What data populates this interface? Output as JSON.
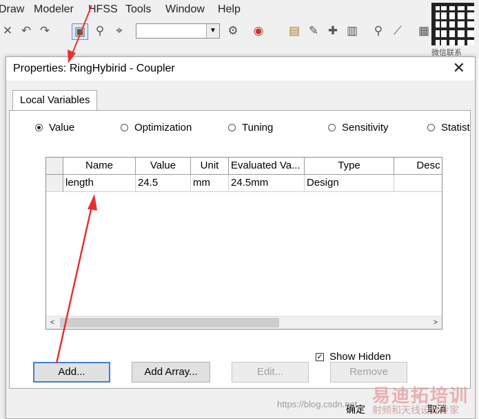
{
  "app": {
    "menu": [
      "Draw",
      "Modeler",
      "HFSS",
      "Tools",
      "Window",
      "Help"
    ],
    "qr_caption": "微信联系"
  },
  "dialog": {
    "title": "Properties: RingHybirid - Coupler",
    "tab": "Local Variables",
    "radios": [
      {
        "label": "Value",
        "selected": true
      },
      {
        "label": "Optimization",
        "selected": false
      },
      {
        "label": "Tuning",
        "selected": false
      },
      {
        "label": "Sensitivity",
        "selected": false
      },
      {
        "label": "Statist",
        "selected": false
      }
    ],
    "table": {
      "columns": [
        "Name",
        "Value",
        "Unit",
        "Evaluated Va...",
        "Type",
        "Desc"
      ],
      "rows": [
        {
          "name": "length",
          "value": "24.5",
          "unit": "mm",
          "evaluated": "24.5mm",
          "type": "Design",
          "desc": ""
        }
      ]
    },
    "show_hidden": {
      "label": "Show Hidden",
      "checked": true
    },
    "buttons": {
      "add": "Add...",
      "add_array": "Add Array...",
      "edit": "Edit...",
      "remove": "Remove"
    },
    "footer": {
      "ok": "确定",
      "cancel": "取消"
    }
  },
  "watermark": {
    "url": "https://blog.csdn.net",
    "logo": "易迪拓培训",
    "tagline": "射频和天线设计专家"
  },
  "colors": {
    "default_button_border": "#3c7fd1",
    "arrow": "#e8312f"
  }
}
